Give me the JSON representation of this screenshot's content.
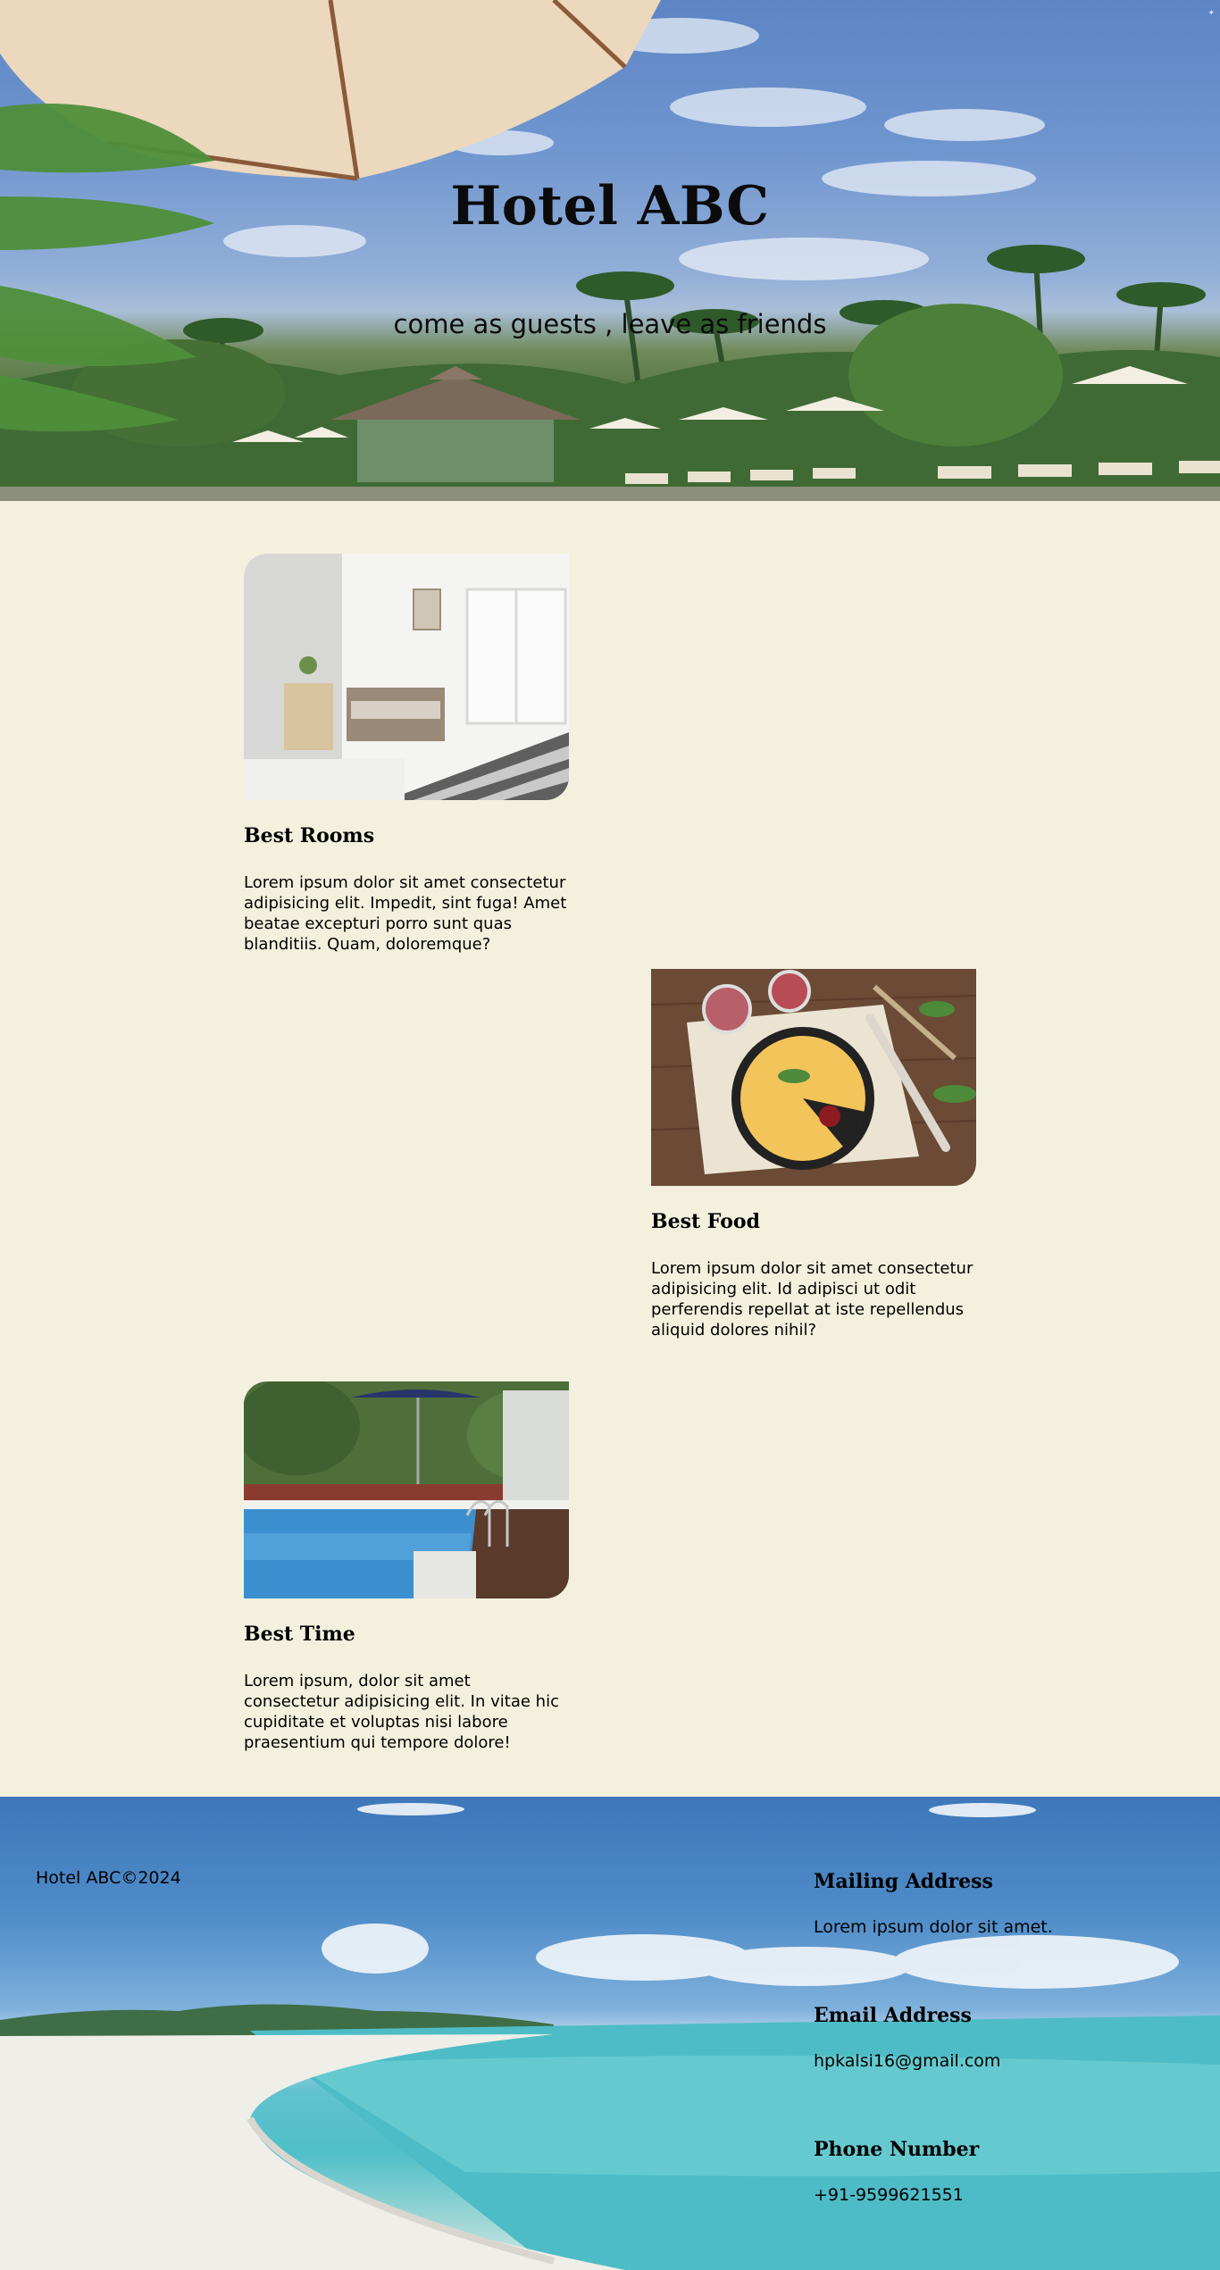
{
  "hero": {
    "title": "Hotel ABC",
    "subtitle": "come as guests , leave as friends",
    "background_image": "tropical-resort-photo"
  },
  "features": [
    {
      "heading": "Best Rooms",
      "text": "Lorem ipsum dolor sit amet consectetur adipisicing elit. Impedit, sint fuga! Amet beatae excepturi porro sunt quas blanditiis. Quam, doloremque?",
      "image": "hotel-room-photo"
    },
    {
      "heading": "Best Food",
      "text": "Lorem ipsum dolor sit amet consectetur adipisicing elit. Id adipisci ut odit perferendis repellat at iste repellendus aliquid dolores nihil?",
      "image": "pie-with-jam-photo"
    },
    {
      "heading": "Best Time",
      "text": "Lorem ipsum, dolor sit amet consectetur adipisicing elit. In vitae hic cupiditate et voluptas nisi labore praesentium qui tempore dolore!",
      "image": "swimming-pool-photo"
    }
  ],
  "footer": {
    "copyright": "Hotel ABC©2024",
    "mailing": {
      "heading": "Mailing Address",
      "value": "Lorem ipsum dolor sit amet."
    },
    "email": {
      "heading": "Email Address",
      "value": "hpkalsi16@gmail.com"
    },
    "phone": {
      "heading": "Phone Number",
      "value": "+91-9599621551"
    },
    "background_image": "beach-photo"
  },
  "colors": {
    "page_background": "#f3f1de",
    "text": "#000000"
  }
}
